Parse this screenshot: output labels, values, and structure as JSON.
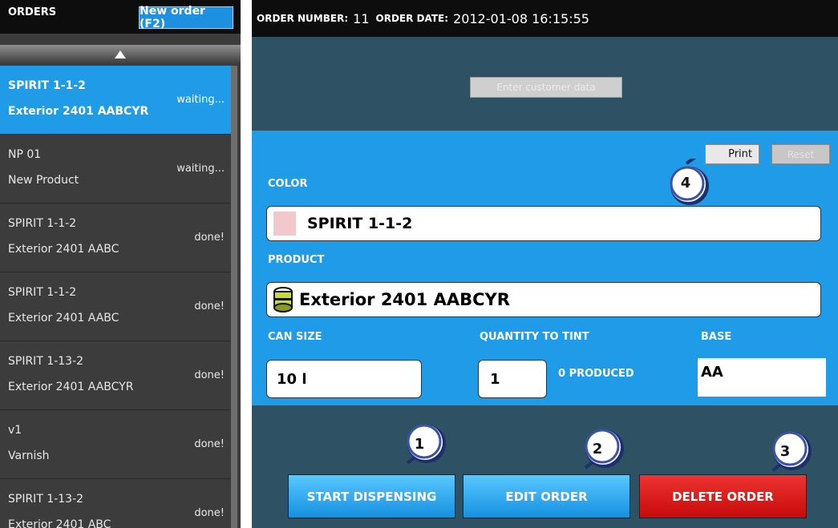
{
  "sidebar": {
    "title": "ORDERS",
    "new_order_label": "New order (F2)",
    "orders": [
      {
        "line1": "SPIRIT 1-1-2",
        "line2": "Exterior 2401 AABCYR",
        "status": "waiting..."
      },
      {
        "line1": "NP 01",
        "line2": "New Product",
        "status": "waiting..."
      },
      {
        "line1": "SPIRIT 1-1-2",
        "line2": "Exterior 2401 AABC",
        "status": "done!"
      },
      {
        "line1": "SPIRIT 1-1-2",
        "line2": "Exterior 2401 AABC",
        "status": "done!"
      },
      {
        "line1": "SPIRIT 1-13-2",
        "line2": "Exterior 2401 AABCYR",
        "status": "done!"
      },
      {
        "line1": "v1",
        "line2": "Varnish",
        "status": "done!"
      },
      {
        "line1": "SPIRIT 1-13-2",
        "line2": "Exterior 2401 ABC",
        "status": "done!"
      }
    ]
  },
  "header": {
    "order_number_label": "ORDER NUMBER:",
    "order_number": "11",
    "order_date_label": "ORDER DATE:",
    "order_date": "2012-01-08 16:15:55"
  },
  "customer": {
    "button_label": "Enter customer data"
  },
  "toolbar": {
    "print_label": "Print",
    "reset_label": "Reset"
  },
  "color": {
    "label": "COLOR",
    "value": "SPIRIT 1-1-2",
    "swatch": "#f2c8cc"
  },
  "product": {
    "label": "PRODUCT",
    "value": "Exterior 2401 AABCYR"
  },
  "can_size": {
    "label": "CAN SIZE",
    "value": "10 l"
  },
  "quantity": {
    "label": "QUANTITY TO TINT",
    "value": "1",
    "produced": "0 PRODUCED"
  },
  "base": {
    "label": "BASE",
    "value": "AA"
  },
  "actions": {
    "start_label": "START DISPENSING",
    "edit_label": "EDIT ORDER",
    "delete_label": "DELETE ORDER"
  },
  "callouts": [
    "1",
    "2",
    "3",
    "4"
  ],
  "colors": {
    "accent_blue": "#1f9be8",
    "panel_bg": "#2e5263",
    "sidebar_bg": "#3c3c3c",
    "delete_red": "#d41414"
  }
}
